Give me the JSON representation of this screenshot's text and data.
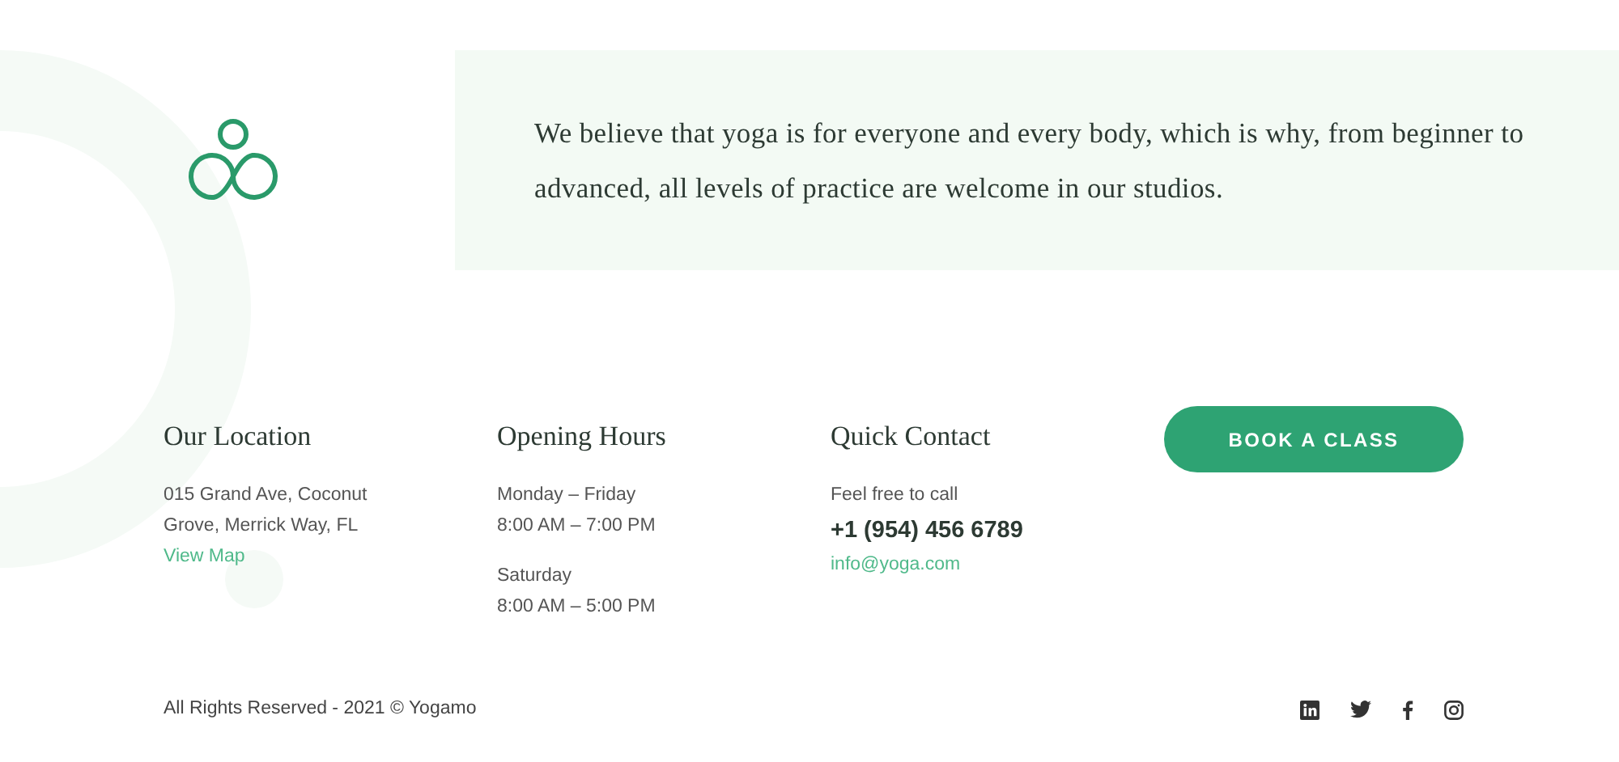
{
  "quote": {
    "text": "We believe that yoga is for everyone and every body, which is why, from beginner to advanced, all levels of practice are welcome in our studios."
  },
  "footer_columns": [
    {
      "heading": "Our Location",
      "groups": [
        [
          {
            "kind": "text",
            "text": "015 Grand Ave, Coconut"
          },
          {
            "kind": "text",
            "text": "Grove, Merrick Way, FL"
          },
          {
            "kind": "link",
            "text": "View Map"
          }
        ]
      ]
    },
    {
      "heading": "Opening Hours",
      "groups": [
        [
          {
            "kind": "text",
            "text": "Monday – Friday"
          },
          {
            "kind": "text",
            "text": "8:00 AM – 7:00 PM"
          }
        ],
        [
          {
            "kind": "text",
            "text": "Saturday"
          },
          {
            "kind": "text",
            "text": "8:00 AM – 5:00 PM"
          }
        ]
      ]
    },
    {
      "heading": "Quick Contact",
      "groups": [
        [
          {
            "kind": "text",
            "text": "Feel free to call"
          },
          {
            "kind": "phone",
            "text": "+1 (954) 456 6789"
          },
          {
            "kind": "link",
            "text": "info@yoga.com"
          }
        ]
      ]
    }
  ],
  "cta_button": {
    "label": "BOOK A CLASS"
  },
  "copyright": "All Rights Reserved - 2021 © Yogamo"
}
